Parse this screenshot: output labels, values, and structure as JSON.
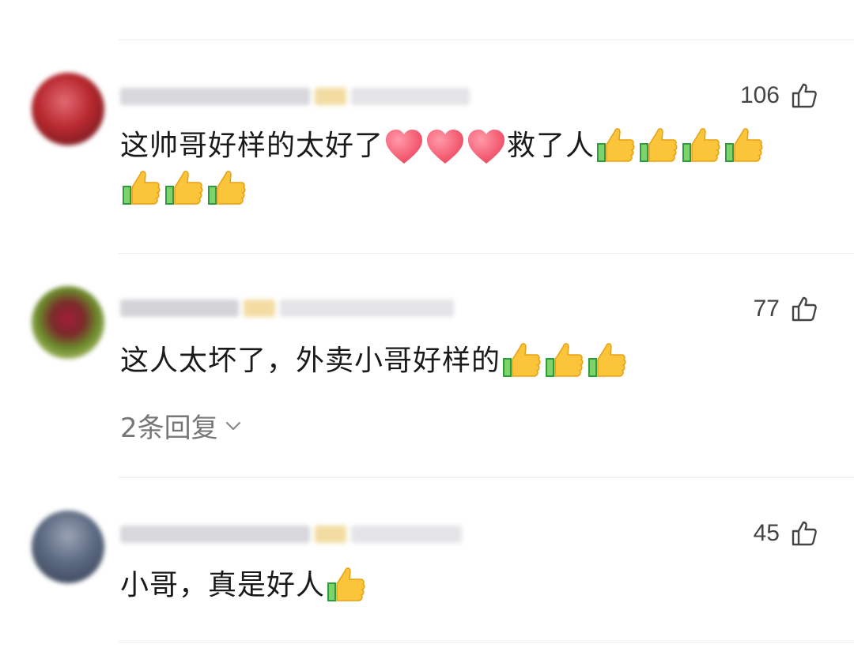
{
  "comments": [
    {
      "likes": "106",
      "text_a": "这帅哥好样的太好了",
      "text_b": "救了人",
      "avatar_colors": [
        "#b8282e",
        "#6b1a22",
        "#e36a73"
      ]
    },
    {
      "likes": "77",
      "text": "这人太坏了，外卖小哥好样的",
      "replies_label": "2条回复",
      "avatar_colors": [
        "#6a8a2c",
        "#a21e3a",
        "#c8d080"
      ]
    },
    {
      "likes": "45",
      "text": "小哥，真是好人",
      "avatar_colors": [
        "#5c6a82",
        "#9aa4b4",
        "#3a4558"
      ]
    }
  ],
  "emoji": {
    "heart": "heart-emoji",
    "thumb": "thumbs-up-emoji"
  },
  "colors": {
    "like_text": "#444444",
    "reply_text": "#777777",
    "divider": "#ececec"
  }
}
